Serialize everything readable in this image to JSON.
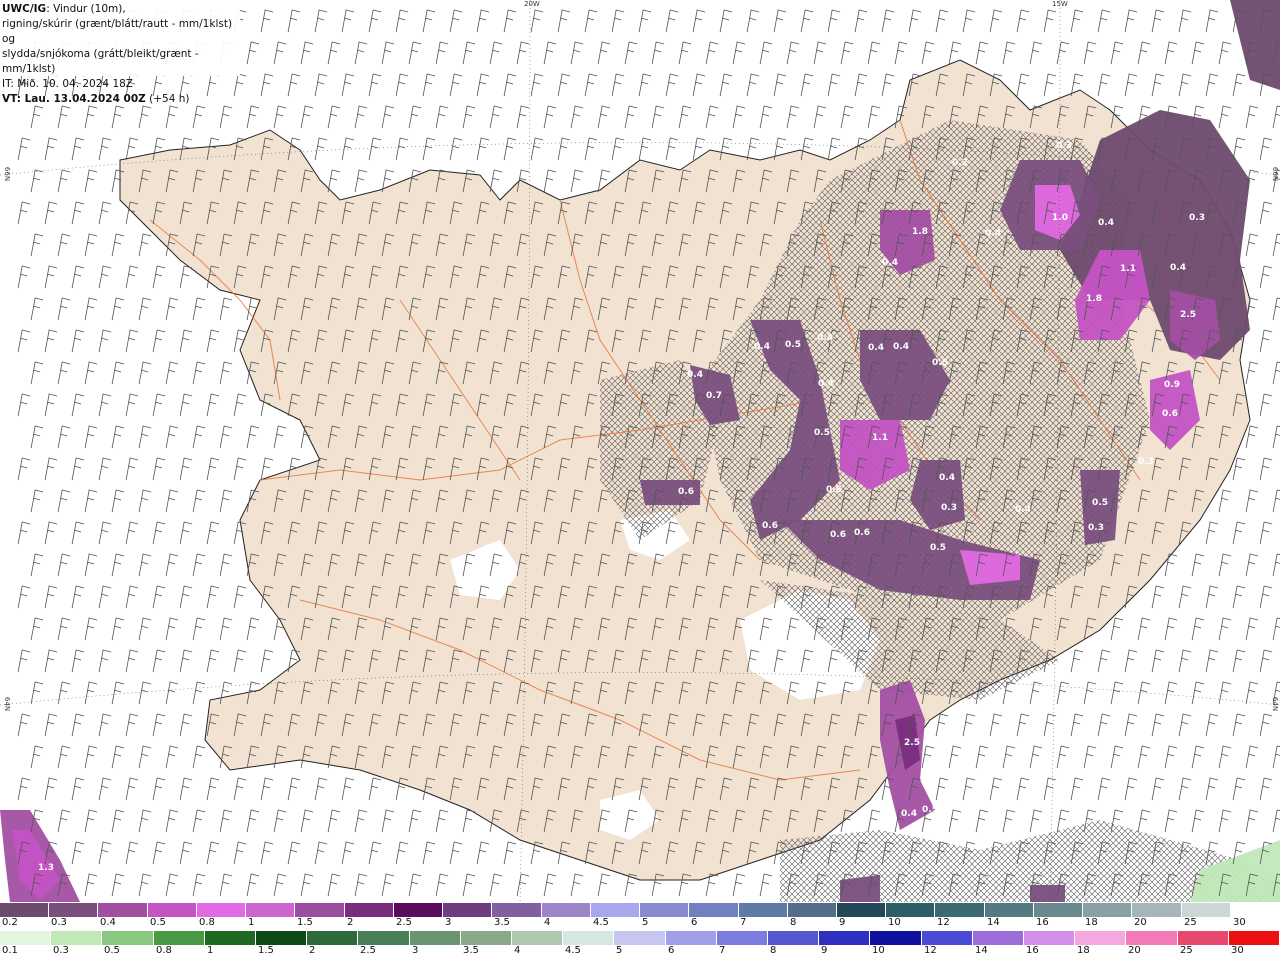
{
  "header": {
    "title_bold": "UWC/IG",
    "title_rest": ": Vindur (10m),",
    "line2": "rigning/skúrir (grænt/blátt/rautt - mm/1klst) og",
    "line3": "slydda/snjókoma (grátt/bleikt/grænt - mm/1klst)",
    "line4": "IT: Mið. 10. 04. 2024 18Z",
    "line5_bold": "VT: Lau. 13.04.2024 00Z",
    "line5_rest": " (+54 h)"
  },
  "graticule": {
    "lon_20w": "20W",
    "lon_15w": "15W",
    "lat_66n": "66N",
    "lat_64n": "64N",
    "lat_66n_right": "66N",
    "lat_64n_right": "64N"
  },
  "precip_labels": [
    "0.3",
    "0.2",
    "1.0",
    "0.4",
    "0.3",
    "0.4",
    "1.8",
    "0.4",
    "1.1",
    "0.4",
    "1.8",
    "2.5",
    "0.4",
    "0.5",
    "0.4",
    "0.4",
    "0.4",
    "0.5",
    "0.4",
    "0.7",
    "0.4",
    "0.5",
    "0.9",
    "1.1",
    "0.6",
    "0.3",
    "0.5",
    "0.6",
    "0.4",
    "0.3",
    "0.3",
    "0.4",
    "0.6",
    "0.3",
    "0.6",
    "0.6",
    "0.5",
    "0.6",
    "2.5",
    "0.4",
    "0.5",
    "1.3"
  ],
  "legend_top": {
    "labels": [
      "0.2",
      "0.3",
      "0.4",
      "0.5",
      "0.8",
      "1",
      "1.5",
      "2",
      "2.5",
      "3",
      "3.5",
      "4",
      "4.5",
      "5",
      "6",
      "7",
      "8",
      "9",
      "10",
      "12",
      "14",
      "16",
      "18",
      "20",
      "25",
      "30"
    ],
    "colors": [
      "#6e4a6e",
      "#7a4f7e",
      "#a24fa2",
      "#c453c4",
      "#e26ae2",
      "#cc66cc",
      "#9b4ea0",
      "#7a2d7e",
      "#5a0b5e",
      "#6e3d7e",
      "#8060a0",
      "#9d86c8",
      "#aaa6ee",
      "#8a8ad0",
      "#7080c0",
      "#607aa6",
      "#526e8c",
      "#244858",
      "#2e5e68",
      "#3c6a72",
      "#527a80",
      "#6a8890",
      "#88a0a4",
      "#a6b6b8",
      "#cdd6d6",
      "#ffffff"
    ]
  },
  "legend_bottom": {
    "labels": [
      "0.1",
      "0.3",
      "0.5",
      "0.8",
      "1",
      "1.5",
      "2",
      "2.5",
      "3",
      "3.5",
      "4",
      "4.5",
      "5",
      "6",
      "7",
      "8",
      "9",
      "10",
      "12",
      "14",
      "16",
      "18",
      "20",
      "25",
      "30"
    ],
    "colors": [
      "#e4f6e0",
      "#c0e8b8",
      "#88c880",
      "#4a9a44",
      "#1e6a22",
      "#0e4a16",
      "#2e6a3a",
      "#4a7e56",
      "#6a9470",
      "#8aa88a",
      "#b0c8b0",
      "#d6e6e0",
      "#c6c6f0",
      "#a0a0e8",
      "#7c7ce0",
      "#5656d0",
      "#3030c0",
      "#10109e",
      "#4a4ad4",
      "#9c6cd8",
      "#d290e8",
      "#f4a8e0",
      "#f27ab8",
      "#e84870",
      "#ee1010"
    ]
  }
}
